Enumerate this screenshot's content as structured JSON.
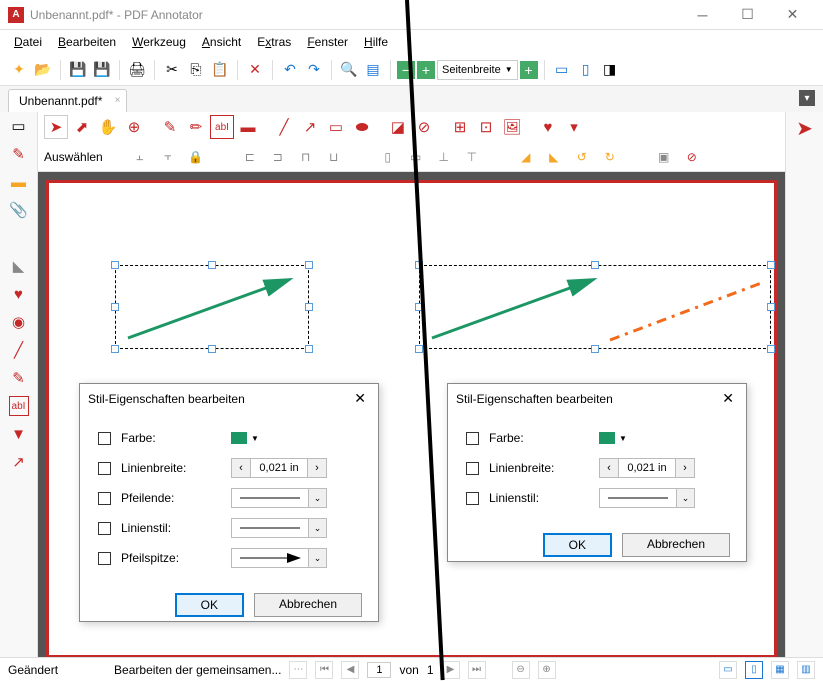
{
  "window": {
    "title": "Unbenannt.pdf* - PDF Annotator",
    "tab_title": "Unbenannt.pdf*"
  },
  "menu": {
    "file": "Datei",
    "edit": "Bearbeiten",
    "tool": "Werkzeug",
    "view": "Ansicht",
    "extras": "Extras",
    "window": "Fenster",
    "help": "Hilfe"
  },
  "toolbar": {
    "zoom_mode": "Seitenbreite"
  },
  "annot_sub": {
    "label": "Auswählen"
  },
  "dialog_left": {
    "title": "Stil-Eigenschaften bearbeiten",
    "fields": {
      "color": "Farbe:",
      "linewidth": "Linienbreite:",
      "arrow_end": "Pfeilende:",
      "linestyle": "Linienstil:",
      "arrow_tip": "Pfeilspitze:"
    },
    "linewidth_value": "0,021 in",
    "ok": "OK",
    "cancel": "Abbrechen"
  },
  "dialog_right": {
    "title": "Stil-Eigenschaften bearbeiten",
    "fields": {
      "color": "Farbe:",
      "linewidth": "Linienbreite:",
      "linestyle": "Linienstil:"
    },
    "linewidth_value": "0,021 in",
    "ok": "OK",
    "cancel": "Abbrechen"
  },
  "status": {
    "changed": "Geändert",
    "task": "Bearbeiten der gemeinsamen...",
    "page_current": "1",
    "page_sep": "von",
    "page_total": "1"
  },
  "colors": {
    "accent": "#c62828",
    "green": "#1b9664",
    "orange": "#f26a1b",
    "blue": "#0078d7"
  }
}
